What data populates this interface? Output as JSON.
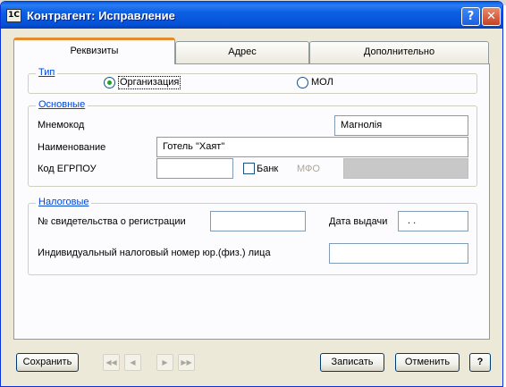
{
  "window": {
    "app_icon": "1C",
    "title": "Контрагент: Исправление",
    "help_glyph": "?",
    "close_glyph": "✕"
  },
  "tabs": [
    {
      "label": "Реквизиты",
      "active": true
    },
    {
      "label": "Адрес",
      "active": false
    },
    {
      "label": "Дополнительно",
      "active": false
    }
  ],
  "type_group": {
    "legend": "Тип",
    "options": [
      {
        "label": "Организация",
        "selected": true
      },
      {
        "label": "МОЛ",
        "selected": false
      }
    ]
  },
  "main_group": {
    "legend": "Основные",
    "mnemo_label": "Мнемокод",
    "mnemo_value": "Магнолія",
    "name_label": "Наименование",
    "name_value": "Готель \"Хаят\"",
    "edrpou_label": "Код ЕГРПОУ",
    "edrpou_value": "",
    "bank_label": "Банк",
    "bank_checked": false,
    "mfo_label": "МФО",
    "mfo_value": ""
  },
  "tax_group": {
    "legend": "Налоговые",
    "cert_label": "№ свидетельства о регистрации",
    "cert_value": "",
    "issue_date_label": "Дата выдачи",
    "issue_date_value": ". .",
    "inn_label": "Индивидуальный налоговый номер юр.(физ.) лица",
    "inn_value": ""
  },
  "footer": {
    "save_label": "Сохранить",
    "nav_first": "◀◀",
    "nav_prev": "◀",
    "nav_next": "▶",
    "nav_last": "▶▶",
    "write_label": "Записать",
    "cancel_label": "Отменить",
    "help_label": "?"
  },
  "colors": {
    "title_bar": "#0a5be6",
    "window_bg": "#ece9d8",
    "panel_bg": "#fcfcfe",
    "active_tab_accent": "#e68b2c",
    "group_legend": "#0046d5",
    "radio_selected": "#21a121"
  }
}
